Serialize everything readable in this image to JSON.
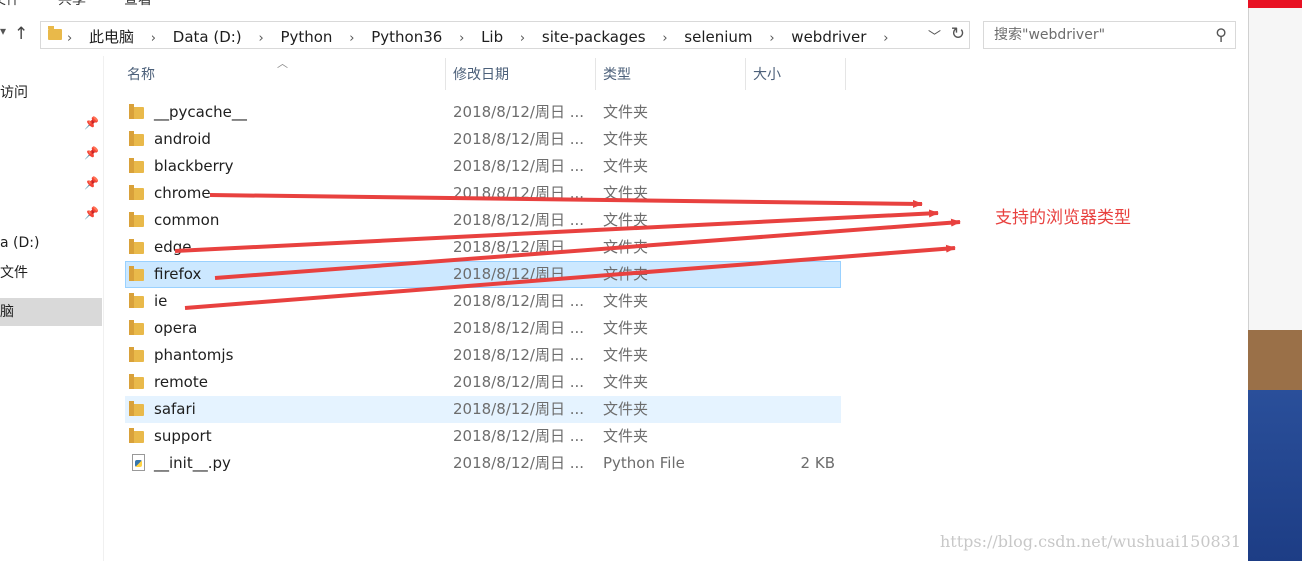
{
  "ribbon": {
    "tabs": [
      "文件",
      "共享",
      "查看"
    ]
  },
  "address": {
    "crumbs": [
      "此电脑",
      "Data (D:)",
      "Python",
      "Python36",
      "Lib",
      "site-packages",
      "selenium",
      "webdriver"
    ]
  },
  "search": {
    "placeholder": "搜索\"webdriver\""
  },
  "sidebar": {
    "items": [
      "访问",
      "",
      "",
      "",
      "",
      "a (D:)",
      "文件",
      "脑"
    ]
  },
  "columns": {
    "name": "名称",
    "date": "修改日期",
    "type": "类型",
    "size": "大小"
  },
  "files": [
    {
      "name": "__pycache__",
      "date": "2018/8/12/周日 ...",
      "type": "文件夹",
      "size": ""
    },
    {
      "name": "android",
      "date": "2018/8/12/周日 ...",
      "type": "文件夹",
      "size": ""
    },
    {
      "name": "blackberry",
      "date": "2018/8/12/周日 ...",
      "type": "文件夹",
      "size": ""
    },
    {
      "name": "chrome",
      "date": "2018/8/12/周日 ...",
      "type": "文件夹",
      "size": ""
    },
    {
      "name": "common",
      "date": "2018/8/12/周日 ...",
      "type": "文件夹",
      "size": ""
    },
    {
      "name": "edge",
      "date": "2018/8/12/周日 ...",
      "type": "文件夹",
      "size": ""
    },
    {
      "name": "firefox",
      "date": "2018/8/12/周日 ...",
      "type": "文件夹",
      "size": ""
    },
    {
      "name": "ie",
      "date": "2018/8/12/周日 ...",
      "type": "文件夹",
      "size": ""
    },
    {
      "name": "opera",
      "date": "2018/8/12/周日 ...",
      "type": "文件夹",
      "size": ""
    },
    {
      "name": "phantomjs",
      "date": "2018/8/12/周日 ...",
      "type": "文件夹",
      "size": ""
    },
    {
      "name": "remote",
      "date": "2018/8/12/周日 ...",
      "type": "文件夹",
      "size": ""
    },
    {
      "name": "safari",
      "date": "2018/8/12/周日 ...",
      "type": "文件夹",
      "size": ""
    },
    {
      "name": "support",
      "date": "2018/8/12/周日 ...",
      "type": "文件夹",
      "size": ""
    },
    {
      "name": "__init__.py",
      "date": "2018/8/12/周日 ...",
      "type": "Python File",
      "size": "2 KB"
    }
  ],
  "annotation": {
    "text": "支持的浏览器类型",
    "color": "#e8413f"
  },
  "watermark": "https://blog.csdn.net/wushuai150831",
  "icons": [
    "back-icon",
    "up-arrow-icon",
    "folder-icon",
    "dropdown-chevron-icon",
    "refresh-icon",
    "search-icon",
    "pin-icon",
    "python-file-icon"
  ]
}
